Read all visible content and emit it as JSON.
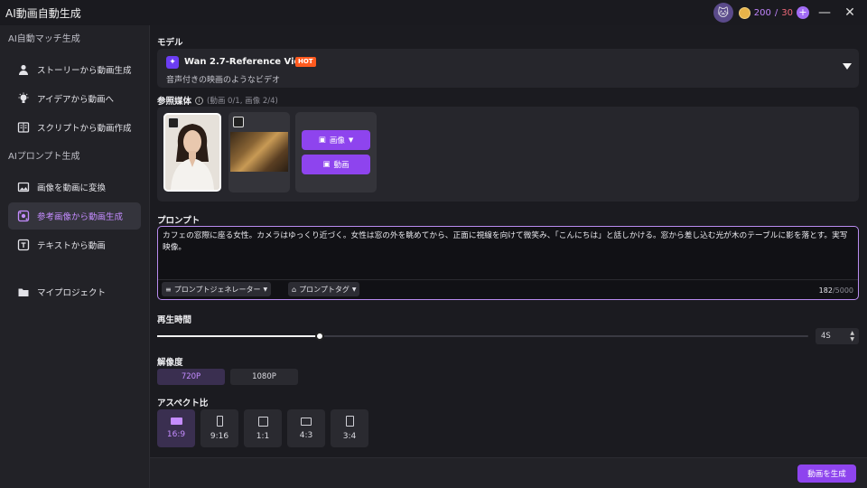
{
  "app": {
    "title": "AI動画自動生成"
  },
  "header": {
    "credits_used": "200",
    "credits_sep": "/",
    "credits_total": "30",
    "plus": "+",
    "minimize": "—",
    "close": "✕"
  },
  "sidebar": {
    "section1": "AI自動マッチ生成",
    "section2": "AIプロンプト生成",
    "items": [
      {
        "label": "ストーリーから動画生成",
        "icon": "person-icon"
      },
      {
        "label": "アイデアから動画へ",
        "icon": "lightbulb-icon"
      },
      {
        "label": "スクリプトから動画作成",
        "icon": "script-icon"
      },
      {
        "label": "画像を動画に変換",
        "icon": "image-icon"
      },
      {
        "label": "参考画像から動画生成",
        "icon": "reference-icon",
        "active": true
      },
      {
        "label": "テキストから動画",
        "icon": "text-icon"
      },
      {
        "label": "マイプロジェクト",
        "icon": "folder-icon"
      }
    ]
  },
  "model": {
    "label": "モデル",
    "name": "Wan 2.7-Reference Video",
    "badge": "HOT",
    "description": "音声付きの映画のようなビデオ"
  },
  "reference": {
    "label": "参照媒体",
    "count": "(動画 0/1, 画像 2/4)",
    "image_button": "画像",
    "video_button": "動画"
  },
  "prompt": {
    "label": "プロンプト",
    "text": "カフェの窓際に座る女性。カメラはゆっくり近づく。女性は窓の外を眺めてから、正面に視線を向けて微笑み、「こんにちは」と話しかける。窓から差し込む光が木のテーブルに影を落とす。実写映像。",
    "generator_chip": "プロンプトジェネレーター",
    "tag_chip": "プロンプトタグ",
    "char_current": "182",
    "char_max": "/5000"
  },
  "duration": {
    "label": "再生時間",
    "value": "4S",
    "slider_fraction": 0.25
  },
  "resolution": {
    "label": "解像度",
    "options": [
      "720P",
      "1080P"
    ],
    "selected": "720P"
  },
  "aspect": {
    "label": "アスペクト比",
    "options": [
      "16:9",
      "9:16",
      "1:1",
      "4:3",
      "3:4"
    ],
    "selected": "16:9"
  },
  "footer": {
    "generate_button": "動画を生成"
  },
  "colors": {
    "accent": "#8e44ee",
    "accent_text": "#c48cff",
    "hot": "#ff5a1f"
  }
}
